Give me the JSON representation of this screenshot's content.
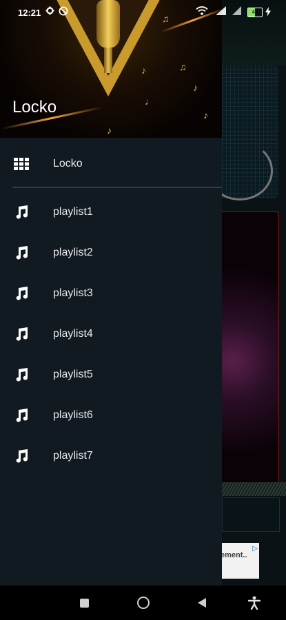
{
  "status_bar": {
    "time": "12:21",
    "battery_level": "48",
    "icons": [
      "gear-icon",
      "no-disturb-icon",
      "wifi-icon",
      "signal-icon",
      "signal-icon",
      "battery-icon",
      "charging-icon"
    ]
  },
  "drawer": {
    "header_title": "Locko",
    "items": [
      {
        "label": "Locko",
        "icon": "grid-icon"
      },
      {
        "label": "playlist1",
        "icon": "music-note-icon"
      },
      {
        "label": "playlist2",
        "icon": "music-note-icon"
      },
      {
        "label": "playlist3",
        "icon": "music-note-icon"
      },
      {
        "label": "playlist4",
        "icon": "music-note-icon"
      },
      {
        "label": "playlist5",
        "icon": "music-note-icon"
      },
      {
        "label": "playlist6",
        "icon": "music-note-icon"
      },
      {
        "label": "playlist7",
        "icon": "music-note-icon"
      }
    ]
  },
  "background": {
    "ad_text": "ement.."
  },
  "nav_bar": {
    "buttons": [
      "recents-button",
      "home-button",
      "back-button",
      "accessibility-button"
    ]
  },
  "colors": {
    "drawer_bg": "#111a21",
    "divider": "#2f3d47",
    "text": "#e6e9ec",
    "nav_bg": "#000000"
  }
}
